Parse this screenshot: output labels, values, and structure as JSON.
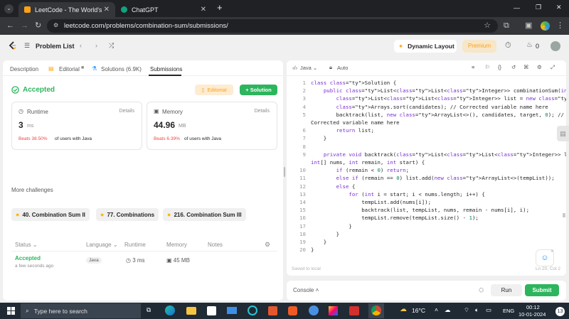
{
  "browser": {
    "tabs": [
      {
        "title": "LeetCode - The World's Leading",
        "close": "✕"
      },
      {
        "title": "ChatGPT",
        "close": "✕"
      }
    ],
    "new_tab": "+",
    "url": "leetcode.com/problems/combination-sum/submissions/",
    "window_controls": [
      "—",
      "❐",
      "✕"
    ]
  },
  "lc_nav": {
    "problem_list": "Problem List",
    "dynamic_layout": "Dynamic Layout",
    "premium": "Premium",
    "streak": "0"
  },
  "left_tabs": [
    {
      "label": "Description"
    },
    {
      "label": "Editorial"
    },
    {
      "label": "Solutions (6.9K)"
    },
    {
      "label": "Submissions"
    }
  ],
  "result": {
    "status": "Accepted",
    "editorial_btn": "Editorial",
    "solution_btn": "+ Solution",
    "runtime": {
      "label": "Runtime",
      "details": "Details",
      "value": "3",
      "unit": "ms",
      "beats": "Beats 38.50%",
      "beats_suffix": "of users with Java"
    },
    "memory": {
      "label": "Memory",
      "details": "Details",
      "value": "44.96",
      "unit": "MB",
      "beats": "Beats 6.39%",
      "beats_suffix": "of users with Java"
    }
  },
  "challenges": {
    "heading": "More challenges",
    "items": [
      "40. Combination Sum II",
      "77. Combinations",
      "216. Combination Sum III"
    ]
  },
  "submissions_table": {
    "headers": [
      "Status",
      "Language",
      "Runtime",
      "Memory",
      "Notes"
    ],
    "rows": [
      {
        "status": "Accepted",
        "time": "a few seconds ago",
        "language": "Java",
        "runtime": "3 ms",
        "memory": "45 MB"
      }
    ]
  },
  "editor": {
    "language": "Java",
    "mode": "Auto",
    "saved": "Saved to local",
    "position": "Ln 20, Col 2",
    "lines": [
      {
        "n": "1",
        "text": "class Solution {"
      },
      {
        "n": "2",
        "text": "    public List<List<Integer>> combinationSum(int[] candidates, int target) {"
      },
      {
        "n": "3",
        "text": "        List<List<Integer>> list = new ArrayList<>();"
      },
      {
        "n": "4",
        "text": "        Arrays.sort(candidates); // Corrected variable name here"
      },
      {
        "n": "5",
        "text": "        backtrack(list, new ArrayList<>(), candidates, target, 0); //"
      },
      {
        "n": "",
        "text": "Corrected variable name here"
      },
      {
        "n": "6",
        "text": "        return list;"
      },
      {
        "n": "7",
        "text": "    }"
      },
      {
        "n": "8",
        "text": ""
      },
      {
        "n": "9",
        "text": "    private void backtrack(List<List<Integer>> list, List<Integer> tempList,"
      },
      {
        "n": "",
        "text": "int[] nums, int remain, int start) {"
      },
      {
        "n": "10",
        "text": "        if (remain < 0) return;"
      },
      {
        "n": "11",
        "text": "        else if (remain == 0) list.add(new ArrayList<>(tempList));"
      },
      {
        "n": "12",
        "text": "        else {"
      },
      {
        "n": "13",
        "text": "            for (int i = start; i < nums.length; i++) {"
      },
      {
        "n": "14",
        "text": "                tempList.add(nums[i]);"
      },
      {
        "n": "15",
        "text": "                backtrack(list, tempList, nums, remain - nums[i], i);"
      },
      {
        "n": "16",
        "text": "                tempList.remove(tempList.size() - 1);"
      },
      {
        "n": "17",
        "text": "            }"
      },
      {
        "n": "18",
        "text": "        }"
      },
      {
        "n": "19",
        "text": "    }"
      },
      {
        "n": "20",
        "text": "}"
      }
    ]
  },
  "console": {
    "label": "Console",
    "run": "Run",
    "submit": "Submit"
  },
  "taskbar": {
    "search_placeholder": "Type here to search",
    "weather": "16°C",
    "lang": "ENG",
    "time": "00:12",
    "date": "10-01-2024",
    "notifications": "13"
  },
  "colors": {
    "accent_green": "#2db55d",
    "premium_orange": "#ffa116"
  }
}
